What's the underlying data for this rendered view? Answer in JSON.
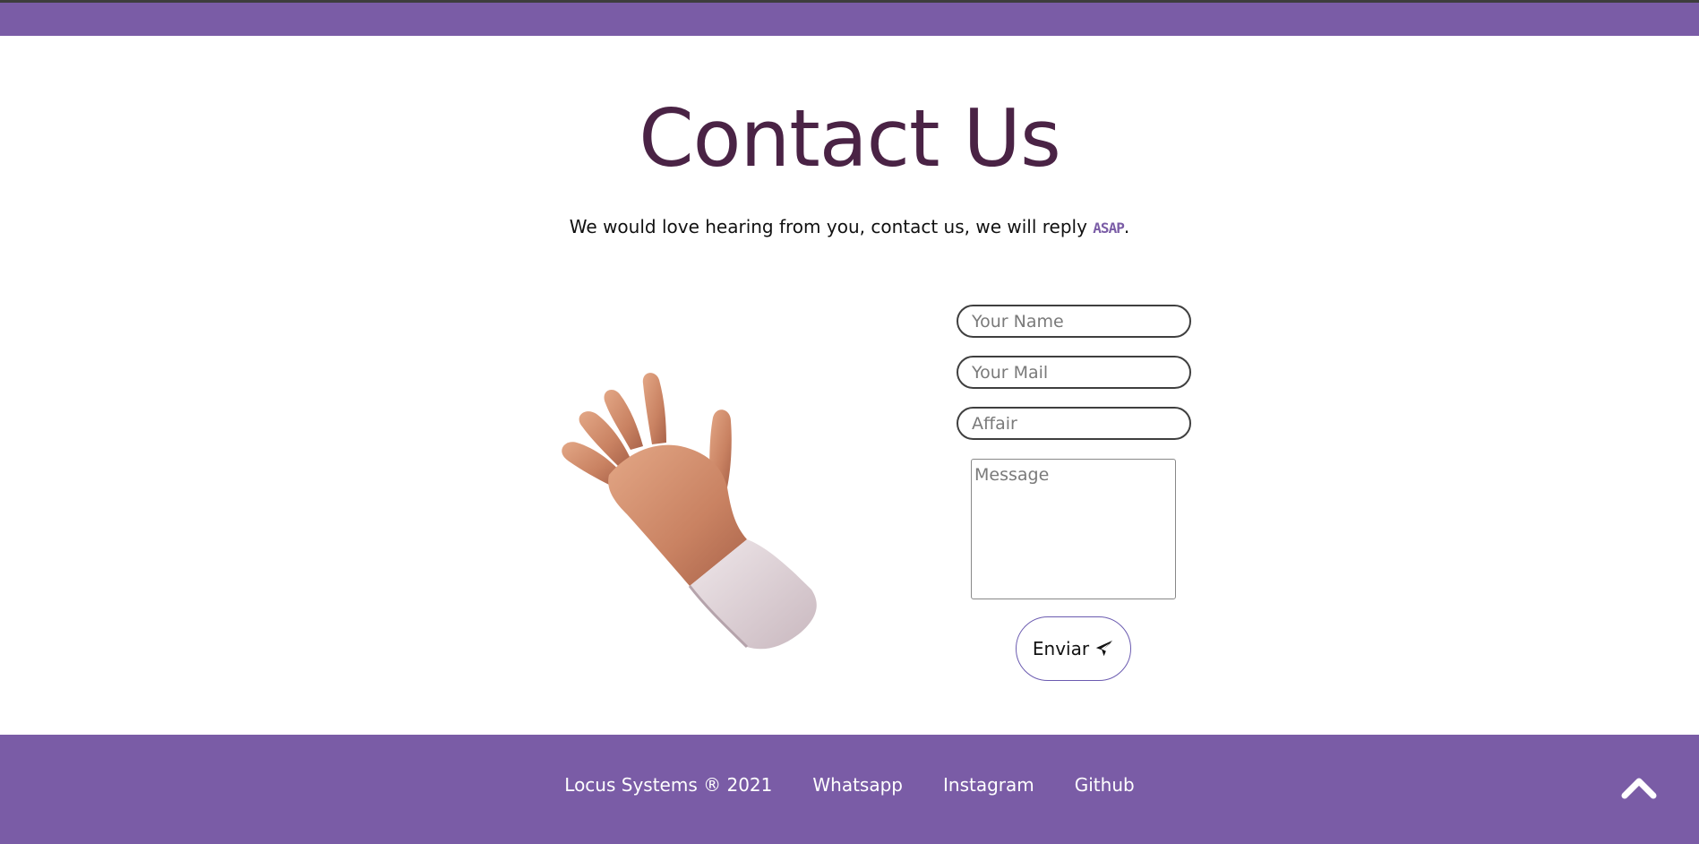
{
  "header": {
    "title": "Contact Us",
    "subtitle_text": "We would love hearing from you, contact us, we will reply ",
    "subtitle_emphasis": "ASAP",
    "subtitle_end": "."
  },
  "form": {
    "name_placeholder": "Your Name",
    "mail_placeholder": "Your Mail",
    "affair_placeholder": "Affair",
    "message_placeholder": "Message",
    "send_label": "Enviar"
  },
  "footer": {
    "copyright": "Locus Systems ® 2021",
    "links": [
      "Whatsapp",
      "Instagram",
      "Github"
    ]
  },
  "icons": {
    "hand": "waving-hand-icon",
    "send": "paper-plane-icon",
    "back_to_top": "chevron-up-icon"
  },
  "colors": {
    "brand": "#7a5ca6",
    "title": "#4a2345"
  }
}
